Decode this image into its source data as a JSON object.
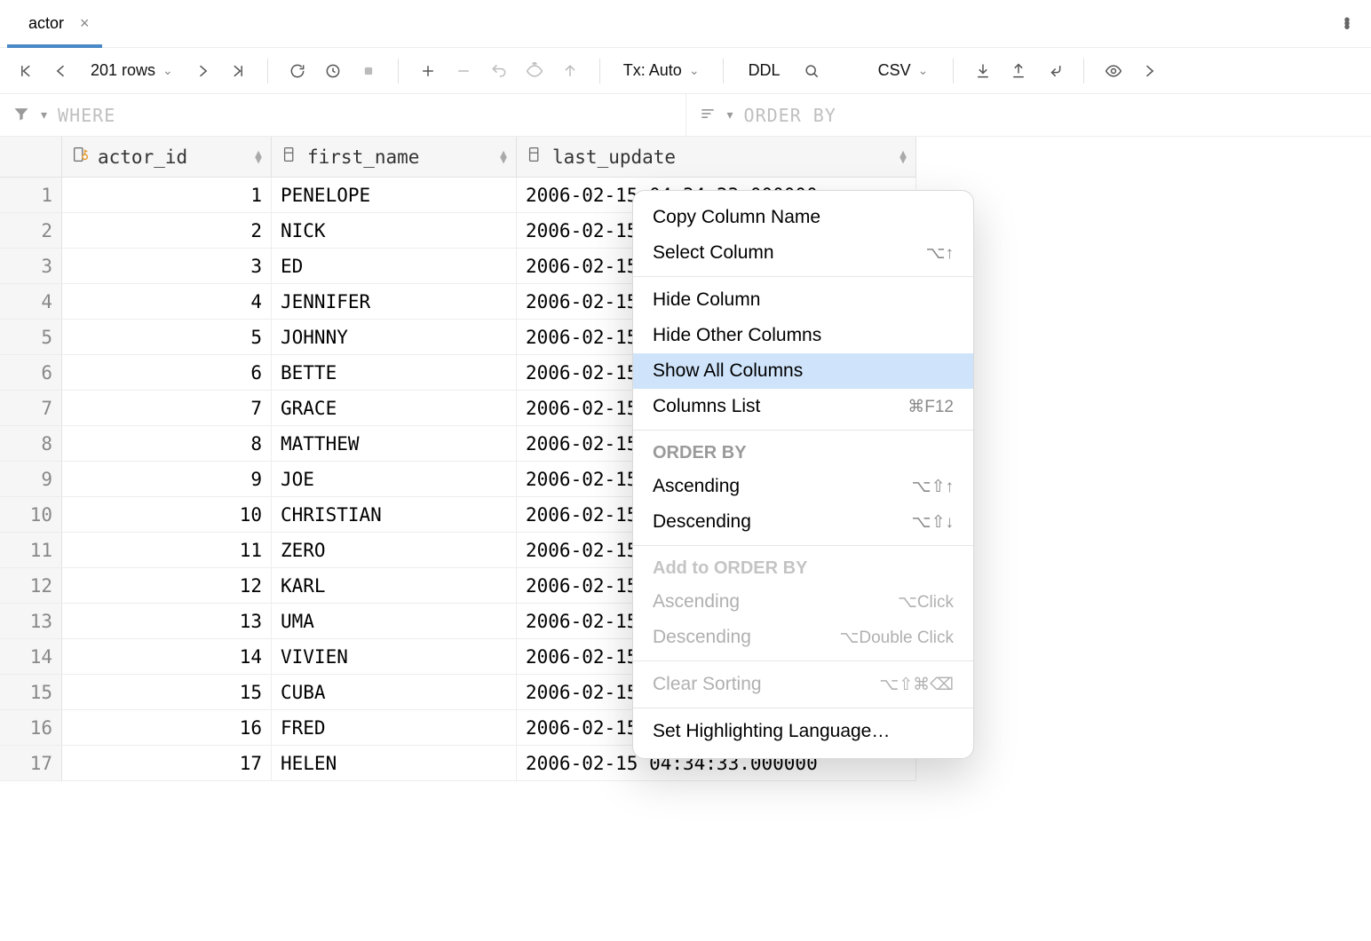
{
  "tab": {
    "title": "actor"
  },
  "toolbar": {
    "rowcount": "201 rows",
    "tx_label": "Tx: Auto",
    "ddl_label": "DDL",
    "csv_label": "CSV"
  },
  "filter": {
    "where_placeholder": "WHERE",
    "orderby_placeholder": "ORDER BY"
  },
  "columns": [
    {
      "name": "actor_id",
      "kind": "pk"
    },
    {
      "name": "first_name",
      "kind": "col"
    },
    {
      "name": "last_update",
      "kind": "col"
    }
  ],
  "rows": [
    {
      "n": "1",
      "actor_id": "1",
      "first_name": "PENELOPE",
      "last_update": "2006-02-15 04:34:33.000000"
    },
    {
      "n": "2",
      "actor_id": "2",
      "first_name": "NICK",
      "last_update": "2006-02-15 04:34:33.000000"
    },
    {
      "n": "3",
      "actor_id": "3",
      "first_name": "ED",
      "last_update": "2006-02-15 04:34:33.000000"
    },
    {
      "n": "4",
      "actor_id": "4",
      "first_name": "JENNIFER",
      "last_update": "2006-02-15 04:34:33.000000"
    },
    {
      "n": "5",
      "actor_id": "5",
      "first_name": "JOHNNY",
      "last_update": "2006-02-15 04:34:33.000000"
    },
    {
      "n": "6",
      "actor_id": "6",
      "first_name": "BETTE",
      "last_update": "2006-02-15 04:34:33.000000"
    },
    {
      "n": "7",
      "actor_id": "7",
      "first_name": "GRACE",
      "last_update": "2006-02-15 04:34:33.000000"
    },
    {
      "n": "8",
      "actor_id": "8",
      "first_name": "MATTHEW",
      "last_update": "2006-02-15 04:34:33.000000"
    },
    {
      "n": "9",
      "actor_id": "9",
      "first_name": "JOE",
      "last_update": "2006-02-15 04:34:33.000000"
    },
    {
      "n": "10",
      "actor_id": "10",
      "first_name": "CHRISTIAN",
      "last_update": "2006-02-15 04:34:33.000000"
    },
    {
      "n": "11",
      "actor_id": "11",
      "first_name": "ZERO",
      "last_update": "2006-02-15 04:34:33.000000"
    },
    {
      "n": "12",
      "actor_id": "12",
      "first_name": "KARL",
      "last_update": "2006-02-15 04:34:33.000000"
    },
    {
      "n": "13",
      "actor_id": "13",
      "first_name": "UMA",
      "last_update": "2006-02-15 04:34:33.000000"
    },
    {
      "n": "14",
      "actor_id": "14",
      "first_name": "VIVIEN",
      "last_update": "2006-02-15 04:34:33.000000"
    },
    {
      "n": "15",
      "actor_id": "15",
      "first_name": "CUBA",
      "last_update": "2006-02-15 04:34:33.000000"
    },
    {
      "n": "16",
      "actor_id": "16",
      "first_name": "FRED",
      "last_update": "2006-02-15 04:34:33.000000"
    },
    {
      "n": "17",
      "actor_id": "17",
      "first_name": "HELEN",
      "last_update": "2006-02-15 04:34:33.000000"
    }
  ],
  "context_menu": {
    "items": [
      {
        "type": "item",
        "label": "Copy Column Name"
      },
      {
        "type": "item",
        "label": "Select Column",
        "kbd": "⌥↑"
      },
      {
        "type": "sep"
      },
      {
        "type": "item",
        "label": "Hide Column"
      },
      {
        "type": "item",
        "label": "Hide Other Columns"
      },
      {
        "type": "item",
        "label": "Show All Columns",
        "highlight": true
      },
      {
        "type": "item",
        "label": "Columns List",
        "kbd": "⌘F12"
      },
      {
        "type": "sep"
      },
      {
        "type": "header",
        "label": "ORDER BY"
      },
      {
        "type": "item",
        "label": "Ascending",
        "kbd": "⌥⇧↑"
      },
      {
        "type": "item",
        "label": "Descending",
        "kbd": "⌥⇧↓"
      },
      {
        "type": "sep"
      },
      {
        "type": "header",
        "label": "Add to ORDER BY",
        "disabled": true
      },
      {
        "type": "item",
        "label": "Ascending",
        "kbd": "⌥Click",
        "disabled": true
      },
      {
        "type": "item",
        "label": "Descending",
        "kbd": "⌥Double Click",
        "disabled": true
      },
      {
        "type": "sep"
      },
      {
        "type": "item",
        "label": "Clear Sorting",
        "kbd": "⌥⇧⌘⌫",
        "disabled": true
      },
      {
        "type": "sep"
      },
      {
        "type": "item",
        "label": "Set Highlighting Language…"
      }
    ]
  }
}
